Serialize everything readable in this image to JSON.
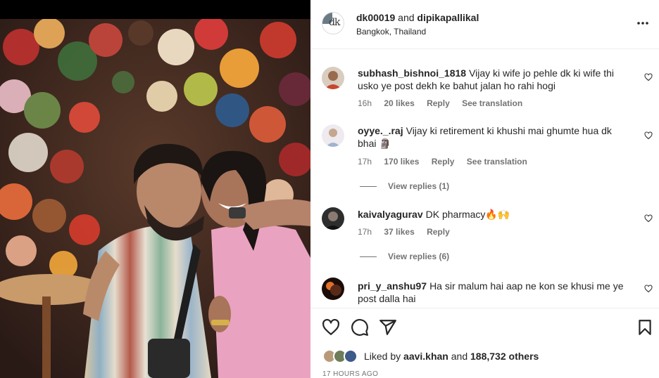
{
  "post": {
    "user_primary": "dk00019",
    "and_text": "and",
    "user_secondary": "dipikapallikal",
    "location": "Bangkok, Thailand",
    "avatar_monogram": "dk"
  },
  "comments": [
    {
      "username": "subhash_bishnoi_1818",
      "text": "Vijay ki wife jo pehle dk ki wife thi usko ye post dekh ke bahut jalan ho rahi hogi",
      "age": "16h",
      "likes": "20 likes",
      "reply": "Reply",
      "translation": "See translation",
      "avatar_color": "#c9b8a6"
    },
    {
      "username": "oyye._.raj",
      "text": "Vijay ki retirement ki khushi mai ghumte hua dk bhai 🗿",
      "age": "17h",
      "likes": "170 likes",
      "reply": "Reply",
      "translation": "See translation",
      "view_replies": "View replies (1)",
      "avatar_color": "#e4dfe6"
    },
    {
      "username": "kaivalyagurav",
      "text": "DK pharmacy🔥🙌",
      "age": "17h",
      "likes": "37 likes",
      "reply": "Reply",
      "view_replies": "View replies (6)",
      "avatar_color": "#2d2d2d"
    },
    {
      "username": "pri_y_anshu97",
      "text": "Ha sir malum hai aap ne kon se khusi me ye post dalla hai",
      "avatar_color": "#3a1a12"
    }
  ],
  "footer": {
    "liked_by_prefix": "Liked by",
    "liked_by_user": "aavi.khan",
    "liked_by_and": "and",
    "liked_by_others": "188,732 others",
    "timestamp": "17 HOURS AGO"
  },
  "icons": {
    "like": "heart-icon",
    "comment": "comment-icon",
    "share": "share-icon",
    "save": "bookmark-icon",
    "more": "more-icon"
  },
  "colors": {
    "text": "#262626",
    "secondary": "#737373",
    "divider": "#efefef"
  }
}
